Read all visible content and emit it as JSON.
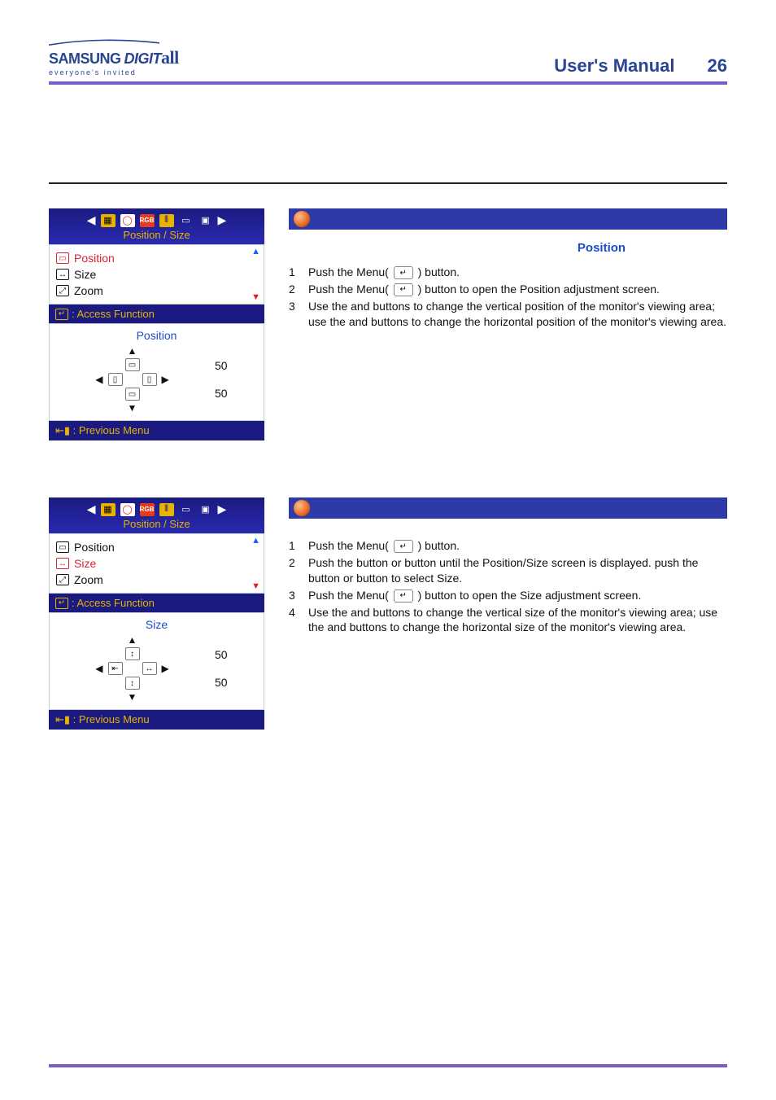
{
  "header": {
    "brand_main": "SAMSUNG",
    "brand_word": "DIGIT",
    "brand_script": "all",
    "brand_tag": "everyone's invited",
    "title": "User's Manual",
    "page": "26"
  },
  "osd_common": {
    "tab_title": "Position / Size",
    "access": ": Access Function",
    "prev": ": Previous Menu",
    "rgb": "RGB"
  },
  "section1": {
    "menu_items": [
      "Position",
      "Size",
      "Zoom"
    ],
    "adj_title": "Position",
    "adj_h": "50",
    "adj_v": "50",
    "right_title": "Position",
    "steps": [
      "Push the Menu( ↵ ) button.",
      "Push the Menu( ↵ ) button to open the Position adjustment screen.",
      "Use the    and    buttons to change the vertical position of the monitor's viewing area; use the    and    buttons to change the horizontal position of the monitor's viewing area."
    ]
  },
  "section2": {
    "menu_items": [
      "Position",
      "Size",
      "Zoom"
    ],
    "adj_title": "Size",
    "adj_h": "50",
    "adj_v": "50",
    "steps": [
      "Push the Menu( ↵ ) button.",
      "Push the    button or    button until the Position/Size screen is displayed. push the    button or    button to select Size.",
      "Push the Menu( ↵ ) button to open the Size adjustment screen.",
      "Use the    and    buttons to change the vertical size of the monitor's viewing area; use the    and    buttons to change the horizontal size of the monitor's viewing area."
    ]
  }
}
